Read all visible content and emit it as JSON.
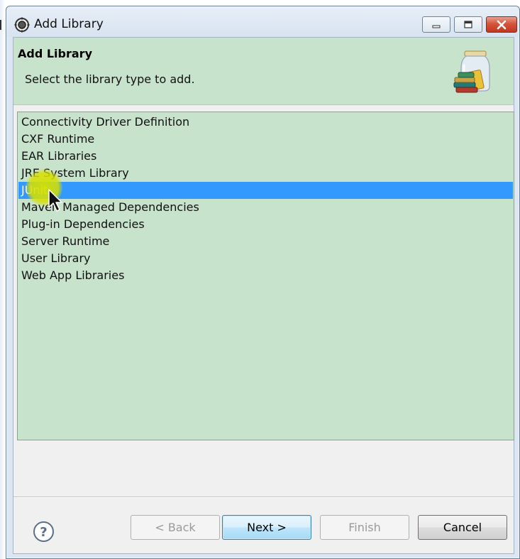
{
  "window": {
    "title": "Add Library"
  },
  "banner": {
    "title": "Add Library",
    "description": "Select the library type to add."
  },
  "library_types": {
    "items": [
      {
        "label": "Connectivity Driver Definition",
        "selected": false
      },
      {
        "label": "CXF Runtime",
        "selected": false
      },
      {
        "label": "EAR Libraries",
        "selected": false
      },
      {
        "label": "JRE System Library",
        "selected": false
      },
      {
        "label": "JUnit",
        "selected": true
      },
      {
        "label": "Maven Managed Dependencies",
        "selected": false
      },
      {
        "label": "Plug-in Dependencies",
        "selected": false
      },
      {
        "label": "Server Runtime",
        "selected": false
      },
      {
        "label": "User Library",
        "selected": false
      },
      {
        "label": "Web App Libraries",
        "selected": false
      }
    ]
  },
  "buttons": {
    "back_label": "< Back",
    "next_label": "Next >",
    "finish_label": "Finish",
    "cancel_label": "Cancel"
  },
  "icons": {
    "app": "eclipse-gear-icon",
    "banner": "library-jar-icon",
    "help": "help-icon",
    "minimize": "minimize-icon",
    "maximize": "maximize-icon",
    "close": "close-icon",
    "cursor": "mouse-pointer-icon"
  },
  "colors": {
    "banner_bg": "#c8e3cc",
    "list_bg": "#c8e3cc",
    "selection": "#3399ff",
    "cursor_highlight": "#d6e000",
    "close_button": "#c2371f"
  }
}
